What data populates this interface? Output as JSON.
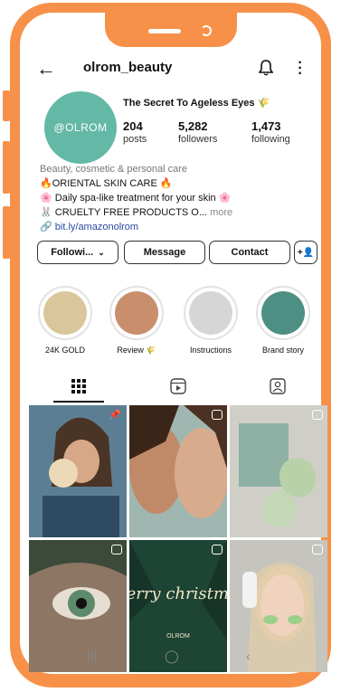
{
  "profile": {
    "username": "olrom_beauty",
    "avatar_text": "@OLROM",
    "bio_title": "The Secret To Ageless Eyes 🌾",
    "stats": [
      {
        "count": "204",
        "label": "posts"
      },
      {
        "count": "5,282",
        "label": "followers"
      },
      {
        "count": "1,473",
        "label": "following"
      }
    ],
    "bio": {
      "category": "Beauty, cosmetic & personal care",
      "line1": "🔥ORIENTAL SKIN CARE 🔥",
      "line2": "🌸 Daily spa-like treatment for your skin 🌸",
      "line3": "🐰 CRUELTY FREE PRODUCTS O...",
      "more": "more",
      "link": "bit.ly/amazonolrom"
    }
  },
  "actions": {
    "following": "Followi...",
    "message": "Message",
    "contact": "Contact"
  },
  "highlights": [
    {
      "label": "24K GOLD",
      "color": "#d9c79b"
    },
    {
      "label": "Review 🌾",
      "color": "#c98f6d"
    },
    {
      "label": "Instructions",
      "color": "#d6d6d6"
    },
    {
      "label": "Brand story",
      "color": "#4e8f83"
    }
  ],
  "grid_posts": [
    {
      "color": "#4a6e86",
      "type": "pinned"
    },
    {
      "color": "#b48a72",
      "type": "reel"
    },
    {
      "color": "#8fb0a4",
      "type": "reel"
    },
    {
      "color": "#3c4a3a",
      "type": "reel"
    },
    {
      "color": "#1d4434",
      "type": "reel",
      "caption": "Merry christmas",
      "sub": "OLROM"
    },
    {
      "color": "#9bb09a",
      "type": "reel"
    }
  ],
  "colors": {
    "frame": "#f7914a",
    "accent": "#63b8a6",
    "link": "#2b4aa0"
  }
}
